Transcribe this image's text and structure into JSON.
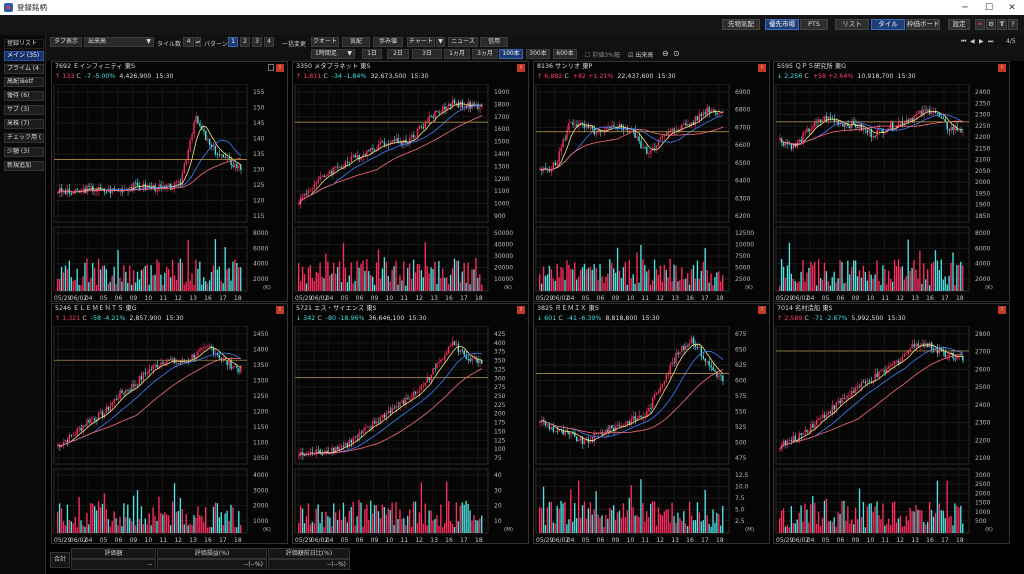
{
  "window": {
    "title": "登録銘柄"
  },
  "topbar": {
    "buttons": [
      {
        "label": "先物気配",
        "on": false
      },
      {
        "label": "優先市場",
        "on": true
      },
      {
        "label": "PTS",
        "on": false
      },
      {
        "label": "リスト",
        "on": false
      },
      {
        "label": "タイル",
        "on": true
      },
      {
        "label": "枠価ボード",
        "on": false
      },
      {
        "label": "設定",
        "on": false
      }
    ],
    "page_indicator": "4/5"
  },
  "toolbar": {
    "tab_display_label": "タブ表示",
    "sort_select": "出来高",
    "tile_count_label": "タイル数",
    "tile_count_value": "4",
    "pattern_label": "パターン",
    "patterns": [
      "1",
      "2",
      "3",
      "4"
    ],
    "bulk_change_label": "一括変更",
    "view_buttons": [
      "クオート",
      "気配",
      "歩み値",
      "チャート",
      "ニュース",
      "信用"
    ],
    "interval_select": "1時間足",
    "ranges": [
      {
        "label": "1日",
        "on": false
      },
      {
        "label": "2日",
        "on": false
      },
      {
        "label": "3日",
        "on": false
      },
      {
        "label": "1ヵ月",
        "on": false
      },
      {
        "label": "3ヵ月",
        "on": false
      },
      {
        "label": "100本",
        "on": true
      },
      {
        "label": "300本",
        "on": false
      },
      {
        "label": "600本",
        "on": false
      }
    ],
    "checkbox_prev_close": "前値3%幅",
    "checkbox_volume": "出来高"
  },
  "sidebar": {
    "header": "登録リスト",
    "items": [
      {
        "label": "メイン (35)",
        "on": true
      },
      {
        "label": "プライム (4",
        "on": false
      },
      {
        "label": "高配当etf",
        "on": false
      },
      {
        "label": "優待 (6)",
        "on": false
      },
      {
        "label": "サブ (3)",
        "on": false
      },
      {
        "label": "米株 (7)",
        "on": false
      },
      {
        "label": "チェック用 (",
        "on": false
      },
      {
        "label": "少額 (3)",
        "on": false
      },
      {
        "label": "新規追加",
        "on": false
      }
    ]
  },
  "colors": {
    "up": "#ff3b6b",
    "down": "#44e0e0",
    "ma_fast": "#f2e88a",
    "ma_mid": "#3f7fff",
    "ma_slow": "#ff6b7a",
    "prev_close": "#c9a252"
  },
  "panels": [
    {
      "code": "7692",
      "name": "Ｅインフィニティ",
      "market": "東S",
      "dir": "up",
      "price": "133",
      "price_flag": "C",
      "change": "-7",
      "change_pct": "-5.00%",
      "volume": "4,426,900",
      "time": "15:30",
      "price_ticks": [
        "155",
        "150",
        "145",
        "140",
        "135",
        "130",
        "125",
        "120",
        "115"
      ],
      "volume_ticks": [
        "8000",
        "6000",
        "4000",
        "2000"
      ],
      "volume_unit": "(K)",
      "x_labels": [
        "05/29",
        "06/02",
        "04",
        "05",
        "06",
        "09",
        "10",
        "11",
        "12",
        "13",
        "16",
        "17",
        "18"
      ]
    },
    {
      "code": "3350",
      "name": "メタプラネット",
      "market": "東S",
      "dir": "up",
      "price": "1,811",
      "price_flag": "C",
      "change": "-34",
      "change_pct": "-1.84%",
      "volume": "32,673,500",
      "time": "15:30",
      "price_ticks": [
        "1900",
        "1800",
        "1700",
        "1600",
        "1500",
        "1400",
        "1300",
        "1200",
        "1100",
        "1000",
        "900"
      ],
      "volume_ticks": [
        "50000",
        "40000",
        "30000",
        "20000",
        "10000"
      ],
      "volume_unit": "(K)",
      "x_labels": [
        "05/29",
        "06/02",
        "04",
        "05",
        "06",
        "09",
        "10",
        "11",
        "12",
        "13",
        "16",
        "17",
        "18"
      ]
    },
    {
      "code": "8136",
      "name": "サンリオ",
      "market": "東P",
      "dir": "up",
      "price": "6,882",
      "price_flag": "C",
      "change": "+82",
      "change_pct": "+1.21%",
      "volume": "22,437,600",
      "time": "15:30",
      "price_ticks": [
        "6900",
        "6800",
        "6700",
        "6600",
        "6500",
        "6400",
        "6300",
        "6200"
      ],
      "volume_ticks": [
        "12500",
        "10000",
        "7500",
        "5000",
        "2500"
      ],
      "volume_unit": "(K)",
      "x_labels": [
        "05/29",
        "06/02",
        "04",
        "05",
        "06",
        "09",
        "10",
        "11",
        "12",
        "13",
        "16",
        "17",
        "18"
      ]
    },
    {
      "code": "5595",
      "name": "ＱＰＳ研究所",
      "market": "東G",
      "dir": "down",
      "price": "2,256",
      "price_flag": "C",
      "change": "+58",
      "change_pct": "+2.64%",
      "volume": "10,918,700",
      "time": "15:30",
      "price_ticks": [
        "2400",
        "2350",
        "2300",
        "2250",
        "2200",
        "2150",
        "2100",
        "2050",
        "2000",
        "1950",
        "1900",
        "1850"
      ],
      "volume_ticks": [
        "8000",
        "6000",
        "4000",
        "2000"
      ],
      "volume_unit": "(K)",
      "x_labels": [
        "05/29",
        "06/02",
        "04",
        "05",
        "06",
        "09",
        "10",
        "11",
        "12",
        "13",
        "16",
        "17",
        "18"
      ]
    },
    {
      "code": "5246",
      "name": "ＥＬＥＭＥＮＴＳ",
      "market": "東G",
      "dir": "up",
      "price": "1,321",
      "price_flag": "C",
      "change": "-58",
      "change_pct": "-4.21%",
      "volume": "2,857,900",
      "time": "15:30",
      "price_ticks": [
        "1450",
        "1400",
        "1350",
        "1300",
        "1250",
        "1200",
        "1150",
        "1100",
        "1050"
      ],
      "volume_ticks": [
        "4000",
        "3000",
        "2000",
        "1000"
      ],
      "volume_unit": "(K)",
      "x_labels": [
        "05/29",
        "06/02",
        "04",
        "05",
        "06",
        "09",
        "10",
        "11",
        "12",
        "13",
        "16",
        "17",
        "18"
      ]
    },
    {
      "code": "5721",
      "name": "エス・サイエンス",
      "market": "東S",
      "dir": "down",
      "price": "342",
      "price_flag": "C",
      "change": "-80",
      "change_pct": "-18.96%",
      "volume": "36,646,100",
      "time": "15:30",
      "price_ticks": [
        "425",
        "400",
        "375",
        "350",
        "325",
        "300",
        "275",
        "250",
        "225",
        "200",
        "175",
        "150",
        "125",
        "100",
        "75"
      ],
      "volume_ticks": [
        "40",
        "30",
        "20",
        "10"
      ],
      "volume_unit": "(M)",
      "x_labels": [
        "05/29",
        "06/02",
        "04",
        "05",
        "06",
        "09",
        "10",
        "11",
        "12",
        "13",
        "16",
        "17",
        "18"
      ]
    },
    {
      "code": "3825",
      "name": "ＲＥＭＩＸ",
      "market": "東S",
      "dir": "down",
      "price": "601",
      "price_flag": "C",
      "change": "-41",
      "change_pct": "-6.39%",
      "volume": "8,818,800",
      "time": "15:30",
      "price_ticks": [
        "675",
        "650",
        "625",
        "600",
        "575",
        "550",
        "525",
        "500",
        "475"
      ],
      "volume_ticks": [
        "12.5",
        "10.0",
        "7.5",
        "5.0",
        "2.5"
      ],
      "volume_unit": "(M)",
      "x_labels": [
        "05/29",
        "06/02",
        "04",
        "05",
        "06",
        "09",
        "10",
        "11",
        "12",
        "13",
        "16",
        "17",
        "18"
      ]
    },
    {
      "code": "7014",
      "name": "名村造船",
      "market": "東S",
      "dir": "up",
      "price": "2,589",
      "price_flag": "C",
      "change": "-71",
      "change_pct": "-2.67%",
      "volume": "5,992,500",
      "time": "15:30",
      "price_ticks": [
        "2800",
        "2700",
        "2600",
        "2500",
        "2400",
        "2300",
        "2200",
        "2100"
      ],
      "volume_ticks": [
        "3000",
        "2500",
        "2000",
        "1500",
        "1000",
        "500"
      ],
      "volume_unit": "(K)",
      "x_labels": [
        "05/29",
        "06/02",
        "04",
        "05",
        "06",
        "09",
        "10",
        "11",
        "12",
        "13",
        "16",
        "17",
        "18"
      ]
    }
  ],
  "bottom": {
    "total_label": "合計",
    "headers": [
      "評価額",
      "評価損益(%)",
      "評価額前日比(%)"
    ],
    "values": [
      "--",
      "--(--%)",
      "--(--%)"
    ]
  }
}
